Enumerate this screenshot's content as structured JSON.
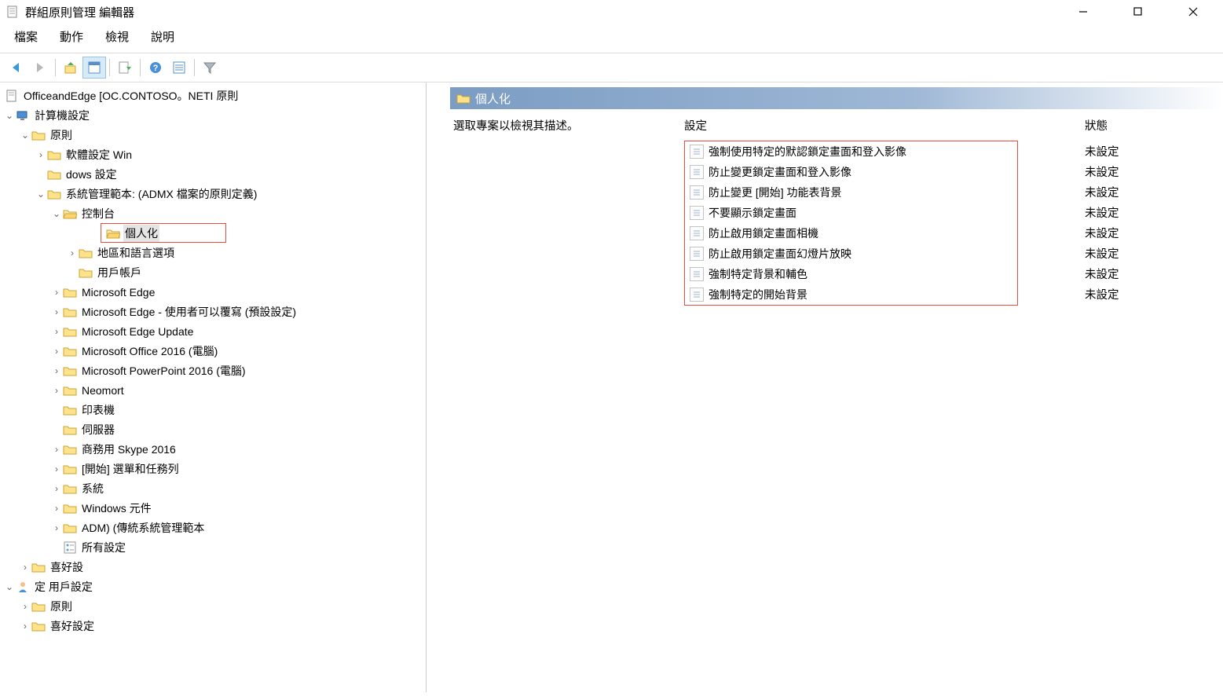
{
  "window": {
    "title": "群組原則管理 編輯器"
  },
  "menu": {
    "file": "檔案",
    "action": "動作",
    "view": "檢視",
    "help": "說明"
  },
  "tree": {
    "root": "OfficeandEdge [OC.CONTOSO。NETI 原則",
    "computer_config": "計算機設定",
    "policy": "原則",
    "software_win": "軟體設定 Win",
    "dows_setting": "dows 設定",
    "admin_templates": "系統管理範本: (ADMX 檔案的原則定義)",
    "control_panel": "控制台",
    "personalization": "個人化",
    "region_language": "地區和語言選項",
    "user_accounts": "用戶帳戶",
    "edge": "Microsoft Edge",
    "edge_override": "Microsoft Edge - 使用者可以覆寫 (預設設定)",
    "edge_update": "Microsoft Edge Update",
    "office2016": "Microsoft Office 2016 (電腦)",
    "ppt2016": "Microsoft PowerPoint 2016 (電腦)",
    "neomort": "Neomort",
    "printer": "印表機",
    "server": "伺服器",
    "skype": "商務用 Skype 2016",
    "start_taskbar": "[開始] 選單和任務列",
    "system": "系統",
    "windows_components": "Windows 元件",
    "adm": "ADM)  (傳統系統管理範本",
    "all_settings": "所有設定",
    "preferences": "喜好設",
    "user_config": "定 用戶設定",
    "policy2": "原則",
    "preferences2": "喜好設定"
  },
  "details": {
    "header": "個人化",
    "desc_prompt": "選取專案以檢視其描述。",
    "col_setting": "設定",
    "col_status": "狀態",
    "settings": [
      "強制使用特定的默認鎖定畫面和登入影像",
      "防止變更鎖定畫面和登入影像",
      "防止變更 [開始] 功能表背景",
      "不要顯示鎖定畫面",
      "防止啟用鎖定畫面相機",
      "防止啟用鎖定畫面幻燈片放映",
      "強制特定背景和輔色",
      "強制特定的開始背景"
    ],
    "status_not_set": "未設定"
  }
}
